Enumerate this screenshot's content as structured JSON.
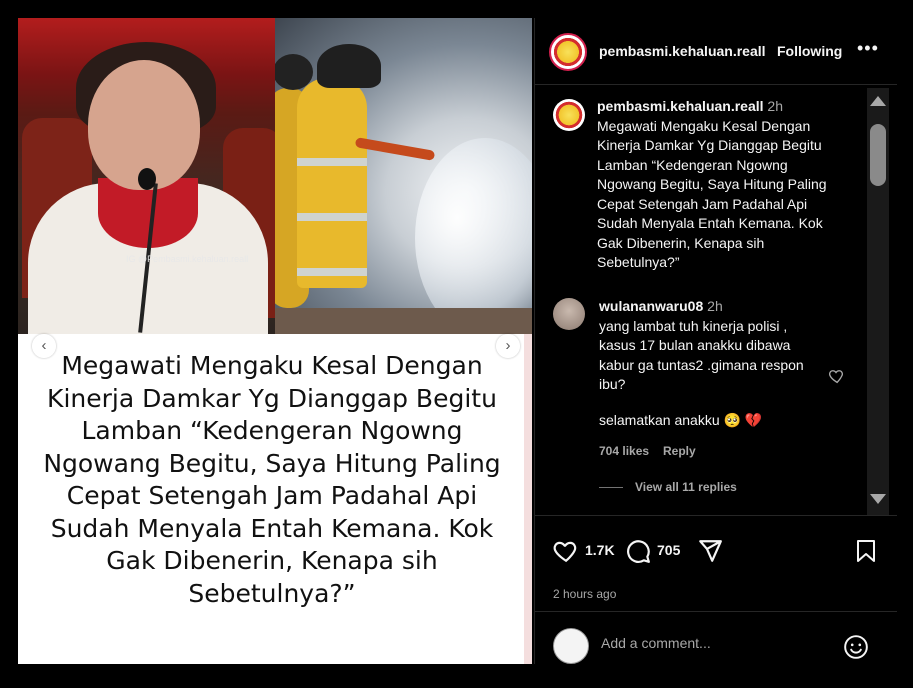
{
  "post": {
    "watermark": "IG @Pembasmi.kehaluan.reall",
    "caption_card_text": "Megawati Mengaku Kesal Dengan Kinerja Damkar Yg Dianggap Begitu Lamban “Kedengeran Ngowng Ngowang Begitu, Saya Hitung Paling Cepat Setengah Jam Padahal Api Sudah Menyala Entah Kemana. Kok Gak Dibenerin, Kenapa sih Sebetulnya?”",
    "carousel": {
      "prev_icon": "chevron-left-icon",
      "next_icon": "chevron-right-icon"
    }
  },
  "header": {
    "username": "pembasmi.kehaluan.reall",
    "follow_status": "Following",
    "more_label": "•••"
  },
  "caption": {
    "username": "pembasmi.kehaluan.reall",
    "time": "2h",
    "text": "Megawati Mengaku Kesal Dengan Kinerja Damkar Yg Dianggap Begitu Lamban “Kedengeran Ngowng Ngowang Begitu, Saya Hitung Paling Cepat Setengah Jam Padahal Api Sudah Menyala Entah Kemana. Kok Gak Dibenerin, Kenapa sih Sebetulnya?”"
  },
  "comment": {
    "username": "wulananwaru08",
    "time": "2h",
    "text": "yang lambat tuh kinerja polisi , kasus 17 bulan anakku dibawa kabur ga tuntas2 .gimana respon ibu?",
    "text2": "selamatkan anakku 🥺 💔",
    "likes": "704 likes",
    "reply_label": "Reply",
    "view_replies": "View all 11 replies"
  },
  "actions": {
    "like_count": "1.7K",
    "comment_count": "705",
    "posted_ago": "2 hours ago"
  },
  "add_comment": {
    "placeholder": "Add a comment..."
  },
  "colors": {
    "background": "#000000",
    "text_primary": "#f5f5f5",
    "text_secondary": "#a8a8a8",
    "divider": "#262626"
  }
}
